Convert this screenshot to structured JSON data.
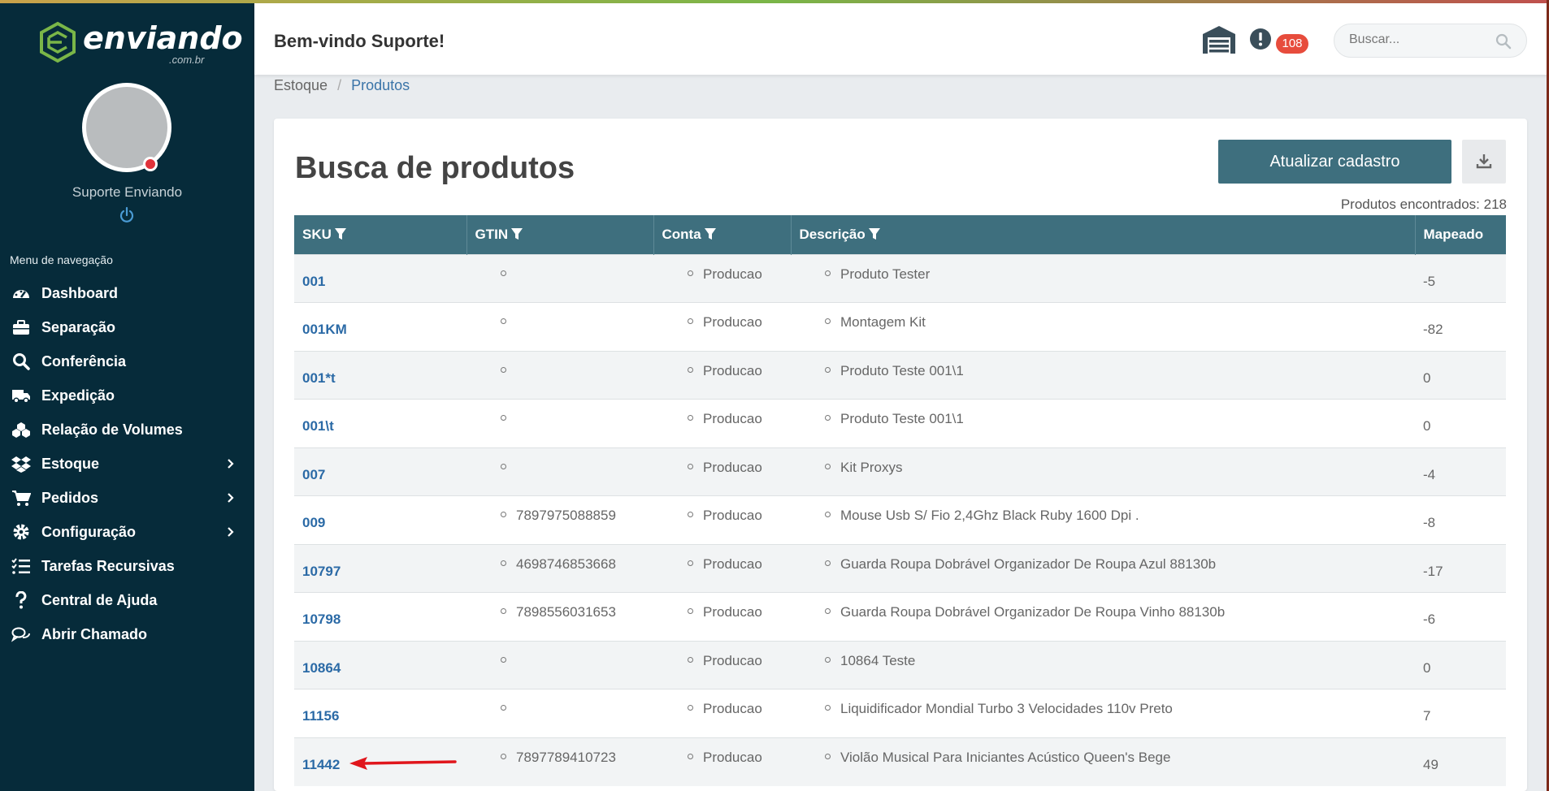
{
  "brand": {
    "name": "enviando",
    "suffix": ".com.br"
  },
  "user": {
    "name": "Suporte Enviando"
  },
  "nav": {
    "title": "Menu de navegação",
    "items": [
      {
        "label": "Dashboard",
        "icon": "dashboard-icon",
        "submenu": false
      },
      {
        "label": "Separação",
        "icon": "briefcase-icon",
        "submenu": false
      },
      {
        "label": "Conferência",
        "icon": "search-icon",
        "submenu": false
      },
      {
        "label": "Expedição",
        "icon": "truck-icon",
        "submenu": false
      },
      {
        "label": "Relação de Volumes",
        "icon": "boxes-icon",
        "submenu": false
      },
      {
        "label": "Estoque",
        "icon": "dropbox-icon",
        "submenu": true
      },
      {
        "label": "Pedidos",
        "icon": "cart-icon",
        "submenu": true
      },
      {
        "label": "Configuração",
        "icon": "gear-icon",
        "submenu": true
      },
      {
        "label": "Tarefas Recursivas",
        "icon": "tasks-icon",
        "submenu": false
      },
      {
        "label": "Central de Ajuda",
        "icon": "question-icon",
        "submenu": false
      },
      {
        "label": "Abrir Chamado",
        "icon": "chat-icon",
        "submenu": false
      }
    ]
  },
  "header": {
    "welcome": "Bem-vindo Suporte!",
    "badge": "108",
    "search_placeholder": "Buscar..."
  },
  "breadcrumb": {
    "parent": "Estoque",
    "current": "Produtos"
  },
  "page": {
    "title": "Busca de produtos",
    "update_button": "Atualizar cadastro",
    "found": "Produtos encontrados: 218"
  },
  "table": {
    "columns": [
      "SKU",
      "GTIN",
      "Conta",
      "Descrição",
      "Mapeado"
    ],
    "rows": [
      {
        "sku": "001",
        "gtin": "",
        "conta": "Producao",
        "descricao": "Produto Tester",
        "mapeado": "-5"
      },
      {
        "sku": "001KM",
        "gtin": "",
        "conta": "Producao",
        "descricao": "Montagem Kit",
        "mapeado": "-82"
      },
      {
        "sku": "001*t",
        "gtin": "",
        "conta": "Producao",
        "descricao": "Produto Teste 001\\1",
        "mapeado": "0"
      },
      {
        "sku": "001\\t",
        "gtin": "",
        "conta": "Producao",
        "descricao": "Produto Teste 001\\1",
        "mapeado": "0"
      },
      {
        "sku": "007",
        "gtin": "",
        "conta": "Producao",
        "descricao": "Kit Proxys",
        "mapeado": "-4"
      },
      {
        "sku": "009",
        "gtin": "7897975088859",
        "conta": "Producao",
        "descricao": "Mouse Usb S/ Fio 2,4Ghz Black Ruby 1600 Dpi .",
        "mapeado": "-8"
      },
      {
        "sku": "10797",
        "gtin": "4698746853668",
        "conta": "Producao",
        "descricao": "Guarda Roupa Dobrável Organizador De Roupa Azul 88130b",
        "mapeado": "-17"
      },
      {
        "sku": "10798",
        "gtin": "7898556031653",
        "conta": "Producao",
        "descricao": "Guarda Roupa Dobrável Organizador De Roupa Vinho 88130b",
        "mapeado": "-6"
      },
      {
        "sku": "10864",
        "gtin": "",
        "conta": "Producao",
        "descricao": "10864 Teste",
        "mapeado": "0"
      },
      {
        "sku": "11156",
        "gtin": "",
        "conta": "Producao",
        "descricao": "Liquidificador Mondial Turbo 3 Velocidades 110v Preto",
        "mapeado": "7"
      },
      {
        "sku": "11442",
        "gtin": "7897789410723",
        "conta": "Producao",
        "descricao": "Violão Musical Para Iniciantes Acústico Queen's Bege",
        "mapeado": "49"
      }
    ]
  },
  "colors": {
    "sidebar": "#062b3a",
    "accent": "#3e6f7e",
    "link": "#2b6aa6",
    "badge": "#e74c3c",
    "annotation_arrow": "#e0161c"
  }
}
